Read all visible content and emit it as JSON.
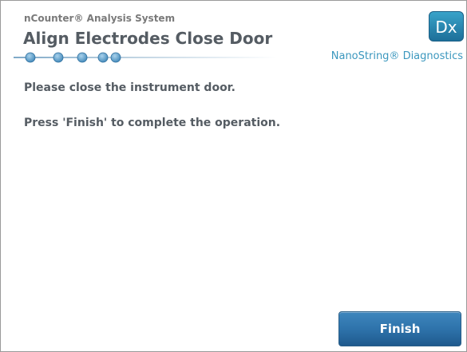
{
  "header": {
    "system_name": "nCounter® Analysis System",
    "page_title": "Align Electrodes Close Door",
    "badge": "Dx",
    "brand": "NanoString® Diagnostics"
  },
  "progress": {
    "total_steps": 5,
    "current_step": 5
  },
  "main": {
    "instructions": [
      "Please close the instrument door.",
      "Press 'Finish' to complete the operation."
    ]
  },
  "footer": {
    "finish_label": "Finish"
  },
  "colors": {
    "accent": "#2e73ab",
    "brand": "#3b97be",
    "title_text": "#555c63"
  }
}
